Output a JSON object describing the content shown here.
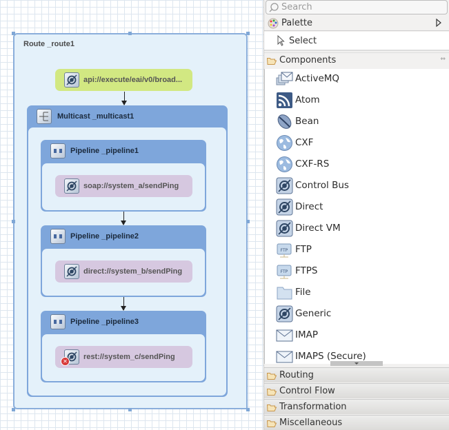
{
  "canvas": {
    "route": {
      "title": "Route _route1"
    },
    "from_endpoint": {
      "label": "api://execute/eai/v0/broad...",
      "icon": "endpoint-icon",
      "color": "#d2e882"
    },
    "multicast": {
      "title": "Multicast _multicast1",
      "icon": "multicast-icon"
    },
    "pipelines": [
      {
        "title": "Pipeline _pipeline1",
        "endpoint": "soap://system_a/sendPing",
        "error": false
      },
      {
        "title": "Pipeline _pipeline2",
        "endpoint": "direct://system_b/sendPing",
        "error": false
      },
      {
        "title": "Pipeline _pipeline3",
        "endpoint": "rest://system_c/sendPing",
        "error": true
      }
    ],
    "error_badge": "✕"
  },
  "palette": {
    "search_placeholder": "Search",
    "title": "Palette",
    "select_label": "Select",
    "components_drawer": "Components",
    "components": [
      {
        "label": "ActiveMQ",
        "icon": "activemq-icon"
      },
      {
        "label": "Atom",
        "icon": "atom-feed-icon"
      },
      {
        "label": "Bean",
        "icon": "bean-icon"
      },
      {
        "label": "CXF",
        "icon": "globe-icon"
      },
      {
        "label": "CXF-RS",
        "icon": "globe-icon"
      },
      {
        "label": "Control Bus",
        "icon": "endpoint-icon"
      },
      {
        "label": "Direct",
        "icon": "endpoint-icon"
      },
      {
        "label": "Direct VM",
        "icon": "endpoint-icon"
      },
      {
        "label": "FTP",
        "icon": "ftp-icon"
      },
      {
        "label": "FTPS",
        "icon": "ftp-icon"
      },
      {
        "label": "File",
        "icon": "folder-icon"
      },
      {
        "label": "Generic",
        "icon": "endpoint-icon"
      },
      {
        "label": "IMAP",
        "icon": "mail-icon"
      },
      {
        "label": "IMAPS (Secure)",
        "icon": "mail-icon"
      }
    ],
    "drawers": [
      "Routing",
      "Control Flow",
      "Transformation",
      "Miscellaneous"
    ]
  }
}
